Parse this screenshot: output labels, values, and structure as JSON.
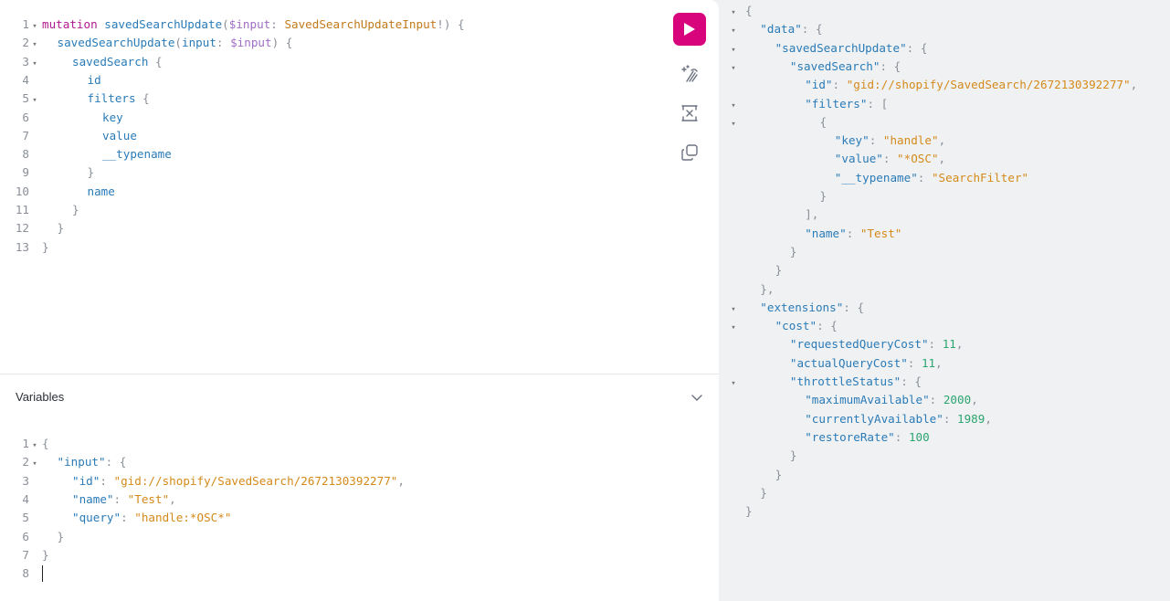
{
  "query_editor": {
    "lines": [
      {
        "n": "1",
        "fold": "▾",
        "indent": 0,
        "tokens": [
          [
            "tk-kw",
            "mutation"
          ],
          [
            "",
            ""
          ],
          [
            "tk-def",
            "savedSearchUpdate"
          ],
          [
            "tk-punc",
            "("
          ],
          [
            "tk-var",
            "$input"
          ],
          [
            "tk-punc",
            ": "
          ],
          [
            "tk-type",
            "SavedSearchUpdateInput"
          ],
          [
            "tk-punc",
            "!) {"
          ]
        ]
      },
      {
        "n": "2",
        "fold": "▾",
        "indent": 1,
        "tokens": [
          [
            "tk-def",
            "savedSearchUpdate"
          ],
          [
            "tk-punc",
            "("
          ],
          [
            "tk-key",
            "input"
          ],
          [
            "tk-punc",
            ": "
          ],
          [
            "tk-var",
            "$input"
          ],
          [
            "tk-punc",
            ") {"
          ]
        ]
      },
      {
        "n": "3",
        "fold": "▾",
        "indent": 2,
        "tokens": [
          [
            "tk-def",
            "savedSearch"
          ],
          [
            "tk-punc",
            " {"
          ]
        ]
      },
      {
        "n": "4",
        "fold": "",
        "indent": 3,
        "tokens": [
          [
            "tk-def",
            "id"
          ]
        ]
      },
      {
        "n": "5",
        "fold": "▾",
        "indent": 3,
        "tokens": [
          [
            "tk-def",
            "filters"
          ],
          [
            "tk-punc",
            " {"
          ]
        ]
      },
      {
        "n": "6",
        "fold": "",
        "indent": 4,
        "tokens": [
          [
            "tk-def",
            "key"
          ]
        ]
      },
      {
        "n": "7",
        "fold": "",
        "indent": 4,
        "tokens": [
          [
            "tk-def",
            "value"
          ]
        ]
      },
      {
        "n": "8",
        "fold": "",
        "indent": 4,
        "tokens": [
          [
            "tk-def",
            "__typename"
          ]
        ]
      },
      {
        "n": "9",
        "fold": "",
        "indent": 3,
        "tokens": [
          [
            "tk-punc",
            "}"
          ]
        ]
      },
      {
        "n": "10",
        "fold": "",
        "indent": 3,
        "tokens": [
          [
            "tk-def",
            "name"
          ]
        ]
      },
      {
        "n": "11",
        "fold": "",
        "indent": 2,
        "tokens": [
          [
            "tk-punc",
            "}"
          ]
        ]
      },
      {
        "n": "12",
        "fold": "",
        "indent": 1,
        "tokens": [
          [
            "tk-punc",
            "}"
          ]
        ]
      },
      {
        "n": "13",
        "fold": "",
        "indent": 0,
        "tokens": [
          [
            "tk-punc",
            "}"
          ]
        ]
      }
    ]
  },
  "toolbar": {
    "run_icon": "play-icon",
    "prettify_icon": "magic-wand-icon",
    "merge_icon": "merge-fragments-icon",
    "copy_icon": "copy-icon",
    "accent_color": "#d8047c"
  },
  "variables": {
    "header_label": "Variables",
    "lines": [
      {
        "n": "1",
        "fold": "▾",
        "indent": 0,
        "tokens": [
          [
            "tk-punc",
            "{"
          ]
        ]
      },
      {
        "n": "2",
        "fold": "▾",
        "indent": 1,
        "tokens": [
          [
            "tk-key",
            "\"input\""
          ],
          [
            "tk-punc",
            ": {"
          ]
        ]
      },
      {
        "n": "3",
        "fold": "",
        "indent": 2,
        "tokens": [
          [
            "tk-key",
            "\"id\""
          ],
          [
            "tk-punc",
            ": "
          ],
          [
            "tk-str",
            "\"gid://shopify/SavedSearch/2672130392277\""
          ],
          [
            "tk-punc",
            ","
          ]
        ]
      },
      {
        "n": "4",
        "fold": "",
        "indent": 2,
        "tokens": [
          [
            "tk-key",
            "\"name\""
          ],
          [
            "tk-punc",
            ": "
          ],
          [
            "tk-str",
            "\"Test\""
          ],
          [
            "tk-punc",
            ","
          ]
        ]
      },
      {
        "n": "5",
        "fold": "",
        "indent": 2,
        "tokens": [
          [
            "tk-key",
            "\"query\""
          ],
          [
            "tk-punc",
            ": "
          ],
          [
            "tk-str",
            "\"handle:*OSC*\""
          ]
        ]
      },
      {
        "n": "6",
        "fold": "",
        "indent": 1,
        "tokens": [
          [
            "tk-punc",
            "}"
          ]
        ]
      },
      {
        "n": "7",
        "fold": "",
        "indent": 0,
        "tokens": [
          [
            "tk-punc",
            "}"
          ]
        ]
      },
      {
        "n": "8",
        "fold": "",
        "indent": 0,
        "tokens": []
      }
    ]
  },
  "result": {
    "lines": [
      {
        "fold": "▾",
        "indent": 0,
        "tokens": [
          [
            "tk-punc",
            "{"
          ]
        ]
      },
      {
        "fold": "▾",
        "indent": 1,
        "tokens": [
          [
            "tk-key",
            "\"data\""
          ],
          [
            "tk-punc",
            ": {"
          ]
        ]
      },
      {
        "fold": "▾",
        "indent": 2,
        "tokens": [
          [
            "tk-key",
            "\"savedSearchUpdate\""
          ],
          [
            "tk-punc",
            ": {"
          ]
        ]
      },
      {
        "fold": "▾",
        "indent": 3,
        "tokens": [
          [
            "tk-key",
            "\"savedSearch\""
          ],
          [
            "tk-punc",
            ": {"
          ]
        ]
      },
      {
        "fold": "",
        "indent": 4,
        "tokens": [
          [
            "tk-key",
            "\"id\""
          ],
          [
            "tk-punc",
            ": "
          ],
          [
            "tk-str",
            "\"gid://shopify/SavedSearch/2672130392277\""
          ],
          [
            "tk-punc",
            ","
          ]
        ]
      },
      {
        "fold": "▾",
        "indent": 4,
        "tokens": [
          [
            "tk-key",
            "\"filters\""
          ],
          [
            "tk-punc",
            ": ["
          ]
        ]
      },
      {
        "fold": "▾",
        "indent": 5,
        "tokens": [
          [
            "tk-punc",
            "{"
          ]
        ]
      },
      {
        "fold": "",
        "indent": 6,
        "tokens": [
          [
            "tk-key",
            "\"key\""
          ],
          [
            "tk-punc",
            ": "
          ],
          [
            "tk-str",
            "\"handle\""
          ],
          [
            "tk-punc",
            ","
          ]
        ]
      },
      {
        "fold": "",
        "indent": 6,
        "tokens": [
          [
            "tk-key",
            "\"value\""
          ],
          [
            "tk-punc",
            ": "
          ],
          [
            "tk-str",
            "\"*OSC\""
          ],
          [
            "tk-punc",
            ","
          ]
        ]
      },
      {
        "fold": "",
        "indent": 6,
        "tokens": [
          [
            "tk-key",
            "\"__typename\""
          ],
          [
            "tk-punc",
            ": "
          ],
          [
            "tk-str",
            "\"SearchFilter\""
          ]
        ]
      },
      {
        "fold": "",
        "indent": 5,
        "tokens": [
          [
            "tk-punc",
            "}"
          ]
        ]
      },
      {
        "fold": "",
        "indent": 4,
        "tokens": [
          [
            "tk-punc",
            "],"
          ]
        ]
      },
      {
        "fold": "",
        "indent": 4,
        "tokens": [
          [
            "tk-key",
            "\"name\""
          ],
          [
            "tk-punc",
            ": "
          ],
          [
            "tk-str",
            "\"Test\""
          ]
        ]
      },
      {
        "fold": "",
        "indent": 3,
        "tokens": [
          [
            "tk-punc",
            "}"
          ]
        ]
      },
      {
        "fold": "",
        "indent": 2,
        "tokens": [
          [
            "tk-punc",
            "}"
          ]
        ]
      },
      {
        "fold": "",
        "indent": 1,
        "tokens": [
          [
            "tk-punc",
            "},"
          ]
        ]
      },
      {
        "fold": "▾",
        "indent": 1,
        "tokens": [
          [
            "tk-key",
            "\"extensions\""
          ],
          [
            "tk-punc",
            ": {"
          ]
        ]
      },
      {
        "fold": "▾",
        "indent": 2,
        "tokens": [
          [
            "tk-key",
            "\"cost\""
          ],
          [
            "tk-punc",
            ": {"
          ]
        ]
      },
      {
        "fold": "",
        "indent": 3,
        "tokens": [
          [
            "tk-key",
            "\"requestedQueryCost\""
          ],
          [
            "tk-punc",
            ": "
          ],
          [
            "tk-num",
            "11"
          ],
          [
            "tk-punc",
            ","
          ]
        ]
      },
      {
        "fold": "",
        "indent": 3,
        "tokens": [
          [
            "tk-key",
            "\"actualQueryCost\""
          ],
          [
            "tk-punc",
            ": "
          ],
          [
            "tk-num",
            "11"
          ],
          [
            "tk-punc",
            ","
          ]
        ]
      },
      {
        "fold": "▾",
        "indent": 3,
        "tokens": [
          [
            "tk-key",
            "\"throttleStatus\""
          ],
          [
            "tk-punc",
            ": {"
          ]
        ]
      },
      {
        "fold": "",
        "indent": 4,
        "tokens": [
          [
            "tk-key",
            "\"maximumAvailable\""
          ],
          [
            "tk-punc",
            ": "
          ],
          [
            "tk-num",
            "2000"
          ],
          [
            "tk-punc",
            ","
          ]
        ]
      },
      {
        "fold": "",
        "indent": 4,
        "tokens": [
          [
            "tk-key",
            "\"currentlyAvailable\""
          ],
          [
            "tk-punc",
            ": "
          ],
          [
            "tk-num",
            "1989"
          ],
          [
            "tk-punc",
            ","
          ]
        ]
      },
      {
        "fold": "",
        "indent": 4,
        "tokens": [
          [
            "tk-key",
            "\"restoreRate\""
          ],
          [
            "tk-punc",
            ": "
          ],
          [
            "tk-num",
            "100"
          ]
        ]
      },
      {
        "fold": "",
        "indent": 3,
        "tokens": [
          [
            "tk-punc",
            "}"
          ]
        ]
      },
      {
        "fold": "",
        "indent": 2,
        "tokens": [
          [
            "tk-punc",
            "}"
          ]
        ]
      },
      {
        "fold": "",
        "indent": 1,
        "tokens": [
          [
            "tk-punc",
            "}"
          ]
        ]
      },
      {
        "fold": "",
        "indent": 0,
        "tokens": [
          [
            "tk-punc",
            "}"
          ]
        ]
      }
    ]
  }
}
